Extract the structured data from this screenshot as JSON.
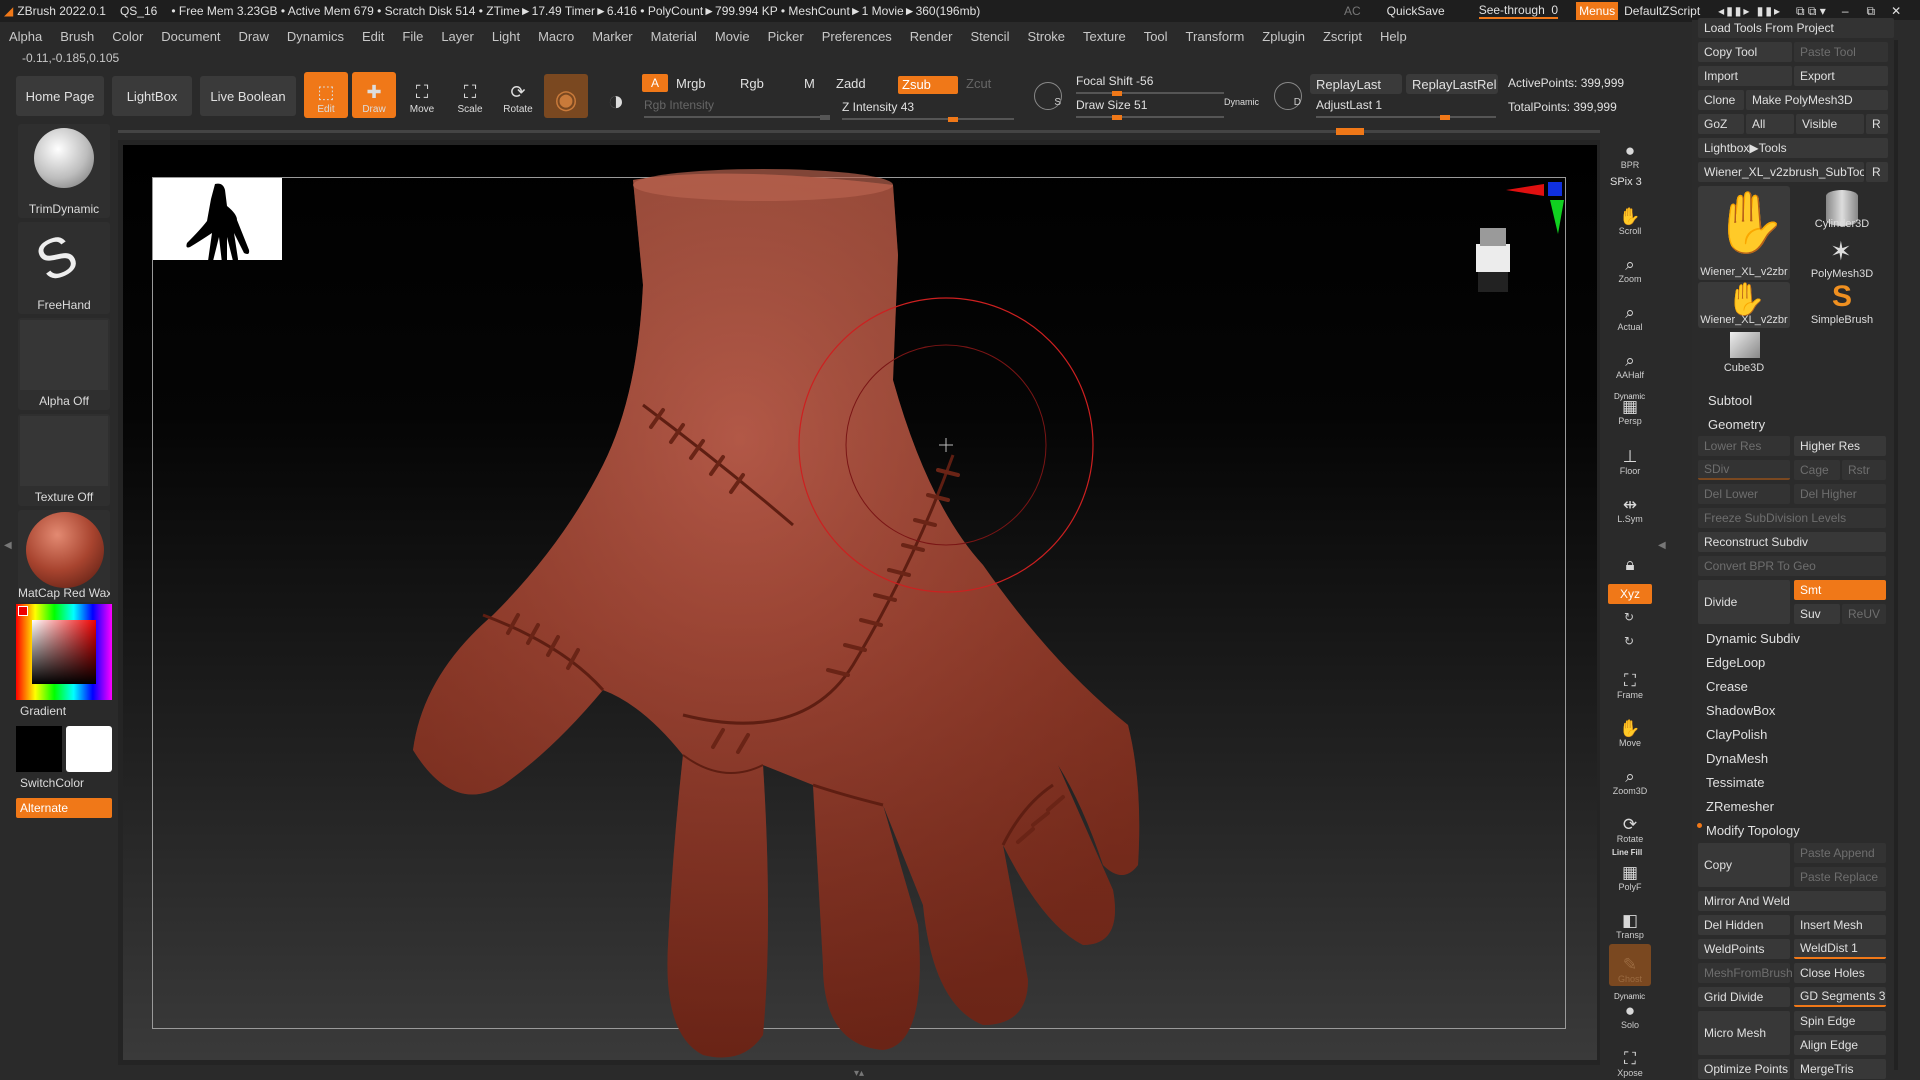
{
  "titlebar": {
    "app": "ZBrush 2022.0.1",
    "doc": "QS_16",
    "stats": "• Free Mem 3.23GB • Active Mem 679 • Scratch Disk 514 • ZTime►17.49 Timer►6.416 • PolyCount►799.994 KP • MeshCount►1  Movie►360(196mb)",
    "ac": "AC",
    "quicksave": "QuickSave",
    "seethrough_label": "See-through",
    "seethrough_value": "0",
    "menus": "Menus",
    "script": "DefaultZScript"
  },
  "menubar": [
    "Alpha",
    "Brush",
    "Color",
    "Document",
    "Draw",
    "Dynamics",
    "Edit",
    "File",
    "Layer",
    "Light",
    "Macro",
    "Marker",
    "Material",
    "Movie",
    "Picker",
    "Preferences",
    "Render",
    "Stencil",
    "Stroke",
    "Texture",
    "Tool",
    "Transform",
    "Zplugin",
    "Zscript",
    "Help"
  ],
  "coords": "-0.11,-0.185,0.105",
  "toolbar": {
    "home": "Home Page",
    "lightbox": "LightBox",
    "liveboolean": "Live Boolean",
    "edit": "Edit",
    "draw": "Draw",
    "move": "Move",
    "scale": "Scale",
    "rotate": "Rotate",
    "a": "A",
    "mrgb": "Mrgb",
    "rgb": "Rgb",
    "m": "M",
    "zadd": "Zadd",
    "zsub": "Zsub",
    "zcut": "Zcut",
    "rgb_intensity": "Rgb Intensity",
    "z_intensity": "Z Intensity 43",
    "focal_shift": "Focal Shift -56",
    "draw_size": "Draw Size 51",
    "dynamic": "Dynamic",
    "replaylast": "ReplayLast",
    "replaylastrel": "ReplayLastRel",
    "adjustlast": "AdjustLast 1",
    "activepoints": "ActivePoints: 399,999",
    "totalpoints": "TotalPoints: 399,999"
  },
  "leftshelf": {
    "brush1": "TrimDynamic",
    "brush2": "FreeHand",
    "alpha": "Alpha Off",
    "texture": "Texture Off",
    "material": "MatCap Red Wax",
    "gradient": "Gradient",
    "switchcolor": "SwitchColor",
    "alternate": "Alternate"
  },
  "rightbar": [
    "BPR",
    "SPix 3",
    "Scroll",
    "Zoom",
    "Actual",
    "AAHalf",
    "Persp",
    "Floor",
    "L.Sym",
    "",
    "Xyz",
    "",
    "",
    "Frame",
    "Move",
    "Zoom3D",
    "Rotate",
    "PolyF",
    "Transp",
    "Ghost",
    "Solo",
    "Xpose"
  ],
  "rightbar_labels": {
    "dynamic": "Dynamic",
    "linefill": "Line Fill"
  },
  "tool": {
    "load_tools": "Load Tools From Project",
    "copy_tool": "Copy Tool",
    "paste_tool": "Paste Tool",
    "import": "Import",
    "export": "Export",
    "clone": "Clone",
    "make_polymesh": "Make PolyMesh3D",
    "goz": "GoZ",
    "all": "All",
    "visible": "Visible",
    "r": "R",
    "lightbox_tools": "Lightbox▶Tools",
    "current_tool": "Wiener_XL_v2zbrush_SubToo",
    "thumbs": [
      "Wiener_XL_v2zbr",
      "Cylinder3D",
      "PolyMesh3D",
      "Wiener_XL_v2zbr",
      "SimpleBrush",
      "Cube3D"
    ]
  },
  "geometry": {
    "subtool": "Subtool",
    "geometry": "Geometry",
    "lower_res": "Lower Res",
    "higher_res": "Higher Res",
    "sdiv": "SDiv",
    "cage": "Cage",
    "rstr": "Rstr",
    "del_lower": "Del Lower",
    "del_higher": "Del Higher",
    "freeze": "Freeze SubDivision Levels",
    "reconstruct": "Reconstruct Subdiv",
    "convert_bpr": "Convert BPR To Geo",
    "divide": "Divide",
    "smt": "Smt",
    "suv": "Suv",
    "reuv": "ReUV",
    "items": [
      "Dynamic Subdiv",
      "EdgeLoop",
      "Crease",
      "ShadowBox",
      "ClayPolish",
      "DynaMesh",
      "Tessimate",
      "ZRemesher"
    ],
    "modify_topology": "Modify Topology",
    "copy": "Copy",
    "paste_append": "Paste Append",
    "paste_replace": "Paste Replace",
    "mirror_weld": "Mirror And Weld",
    "del_hidden": "Del Hidden",
    "insert_mesh": "Insert Mesh",
    "weldpoints": "WeldPoints",
    "welddist": "WeldDist 1",
    "meshfrombrush": "MeshFromBrush",
    "close_holes": "Close Holes",
    "grid_divide": "Grid Divide",
    "gd_segments": "GD Segments 3",
    "micro_mesh": "Micro Mesh",
    "spin_edge": "Spin Edge",
    "align_edge": "Align Edge",
    "optimize_points": "Optimize Points",
    "mergetris": "MergeTris"
  },
  "colors": {
    "accent": "#f07818",
    "panel": "#2b2b2b",
    "clay": "#a8442f"
  }
}
